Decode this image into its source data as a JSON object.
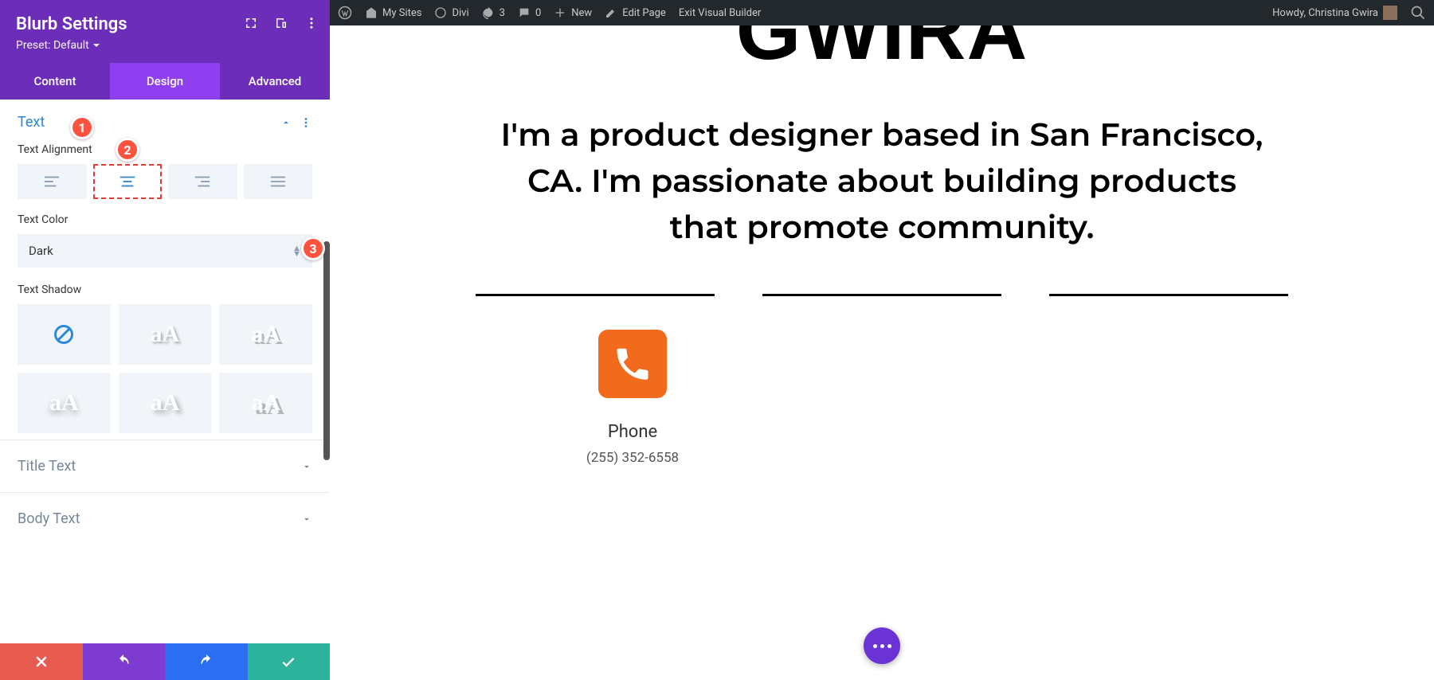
{
  "sidebar": {
    "title": "Blurb Settings",
    "preset": "Preset: Default",
    "tabs": {
      "content": "Content",
      "design": "Design",
      "advanced": "Advanced"
    },
    "sections": {
      "text": {
        "title": "Text",
        "alignment_label": "Text Alignment",
        "color_label": "Text Color",
        "color_value": "Dark",
        "shadow_label": "Text Shadow"
      },
      "title_text": "Title Text",
      "body_text": "Body Text"
    }
  },
  "callouts": {
    "c1": "1",
    "c2": "2",
    "c3": "3"
  },
  "adminbar": {
    "my_sites": "My Sites",
    "divi": "Divi",
    "updates": "3",
    "comments": "0",
    "new": "New",
    "edit": "Edit Page",
    "exit": "Exit Visual Builder",
    "howdy": "Howdy, Christina Gwira"
  },
  "page": {
    "logo": "GWIRA",
    "intro": "I'm a product designer based in San Francisco, CA. I'm passionate about building products that promote community.",
    "blurb_title": "Phone",
    "blurb_text": "(255) 352-6558"
  }
}
